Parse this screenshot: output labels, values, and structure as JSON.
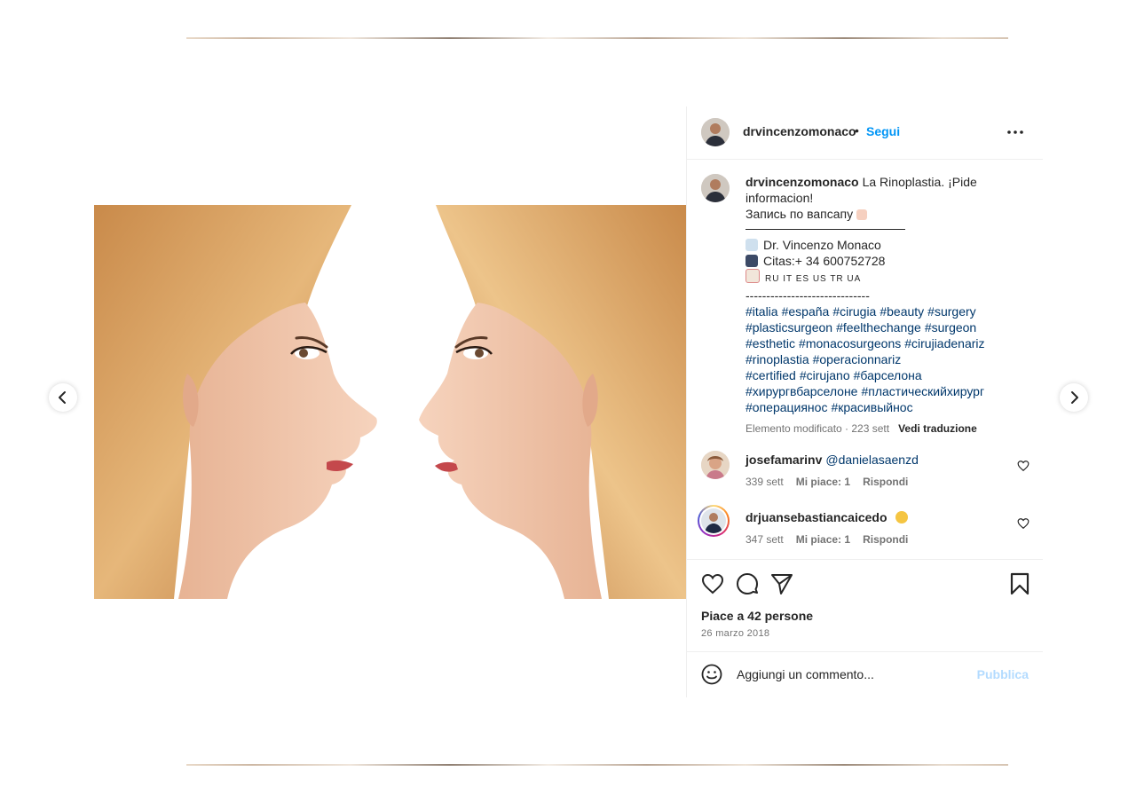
{
  "post": {
    "username": "drvincenzomonaco",
    "dot": "•",
    "follow_label": "Segui",
    "more_icon": "more-options-icon"
  },
  "caption": {
    "username": "drvincenzomonaco",
    "line1": "La Rinoplastia. ¡Pide",
    "line2": "informacion!",
    "line3": "Запись по вапсапу",
    "line3_emoji": "pointing-hand-emoji",
    "doctor": "Dr. Vincenzo Monaco",
    "doctor_emoji": "doctor-emoji",
    "phone": "Citas:+ 34 600752728",
    "phone_emoji": "phone-emoji",
    "languages": "RU IT ES US TR UA",
    "languages_emoji": "memo-emoji",
    "divider": "------------------------------",
    "hashtags": [
      "#italia",
      "#españa",
      "#cirugia",
      "#beauty",
      "#surgery",
      "#plasticsurgeon",
      "#feelthechange",
      "#surgeon",
      "#esthetic",
      "#monacosurgeons",
      "#cirujiadenariz",
      "#rinoplastia",
      "#operacionnariz",
      "#certified",
      "#cirujano",
      "#барселона",
      "#хирургвбарселоне",
      "#пластическийхирург",
      "#операцияноc",
      "#красивыйнос"
    ],
    "edited": "Elemento modificato · 223 sett",
    "translate_label": "Vedi traduzione"
  },
  "comments": [
    {
      "username": "josefamarinv",
      "mention": "@danielasaenzd",
      "time": "339 sett",
      "likes": "Mi piace: 1",
      "reply": "Rispondi"
    },
    {
      "username": "drjuansebastiancaicedo",
      "emoji": "clapping-hands-emoji",
      "time": "347 sett",
      "likes": "Mi piace: 1",
      "reply": "Rispondi"
    }
  ],
  "actions": {
    "likes_text": "Piace a 42 persone",
    "date": "26 marzo 2018"
  },
  "add_comment": {
    "placeholder": "Aggiungi un commento...",
    "publish_label": "Pubblica"
  },
  "colors": {
    "link": "#0095f6",
    "hashtag": "#00376b",
    "muted": "#737373",
    "publish_disabled": "#b3dbff"
  }
}
